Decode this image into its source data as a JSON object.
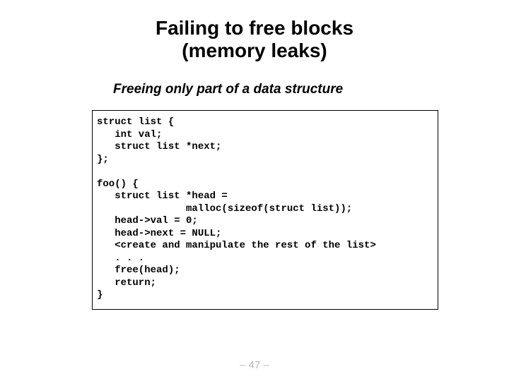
{
  "title_line1": "Failing to free blocks",
  "title_line2": "(memory leaks)",
  "subtitle": "Freeing only part of a data structure",
  "code": "struct list {\n   int val;\n   struct list *next;\n};\n\nfoo() {\n   struct list *head =\n               malloc(sizeof(struct list));\n   head->val = 0;\n   head->next = NULL;\n   <create and manipulate the rest of the list>\n   . . .\n   free(head);\n   return;\n}",
  "page_number": "– 47 –"
}
